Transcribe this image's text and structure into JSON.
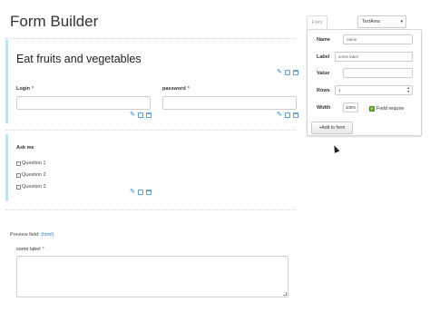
{
  "header": {
    "title": "Form Builder"
  },
  "canvas": {
    "heading_block": {
      "title": "Eat fruits and vegetables"
    },
    "login_field": {
      "label": "Login",
      "required_mark": "*"
    },
    "password_field": {
      "label": "password",
      "required_mark": "*"
    },
    "ask_block": {
      "label": "Ask me",
      "options": [
        "Question 1",
        "Question 2",
        "Question 3"
      ]
    }
  },
  "preview": {
    "label": "Preview field:",
    "link": "(html)",
    "field_label": "some label",
    "required_mark": "*"
  },
  "panel": {
    "tab_label": "Form",
    "type_select": {
      "value": "TextArea"
    },
    "name": {
      "label": "Name",
      "value": "name"
    },
    "label": {
      "label": "Label",
      "value": "some label"
    },
    "value": {
      "label": "Value",
      "value": ""
    },
    "rows": {
      "label": "Rows",
      "value": "4"
    },
    "width": {
      "label": "Width",
      "value": "100%"
    },
    "required": {
      "label": "Field require",
      "checked": true
    },
    "add_button": {
      "label": "+Add to form"
    }
  },
  "colors": {
    "accent_border": "#bfe3ee",
    "link": "#2a7fd2",
    "required": "#c33333",
    "checkbox_checked": "#6cae3e"
  },
  "icons": [
    "edit-icon",
    "copy-icon",
    "delete-icon",
    "chevron-down-icon",
    "mouse-cursor-icon"
  ]
}
